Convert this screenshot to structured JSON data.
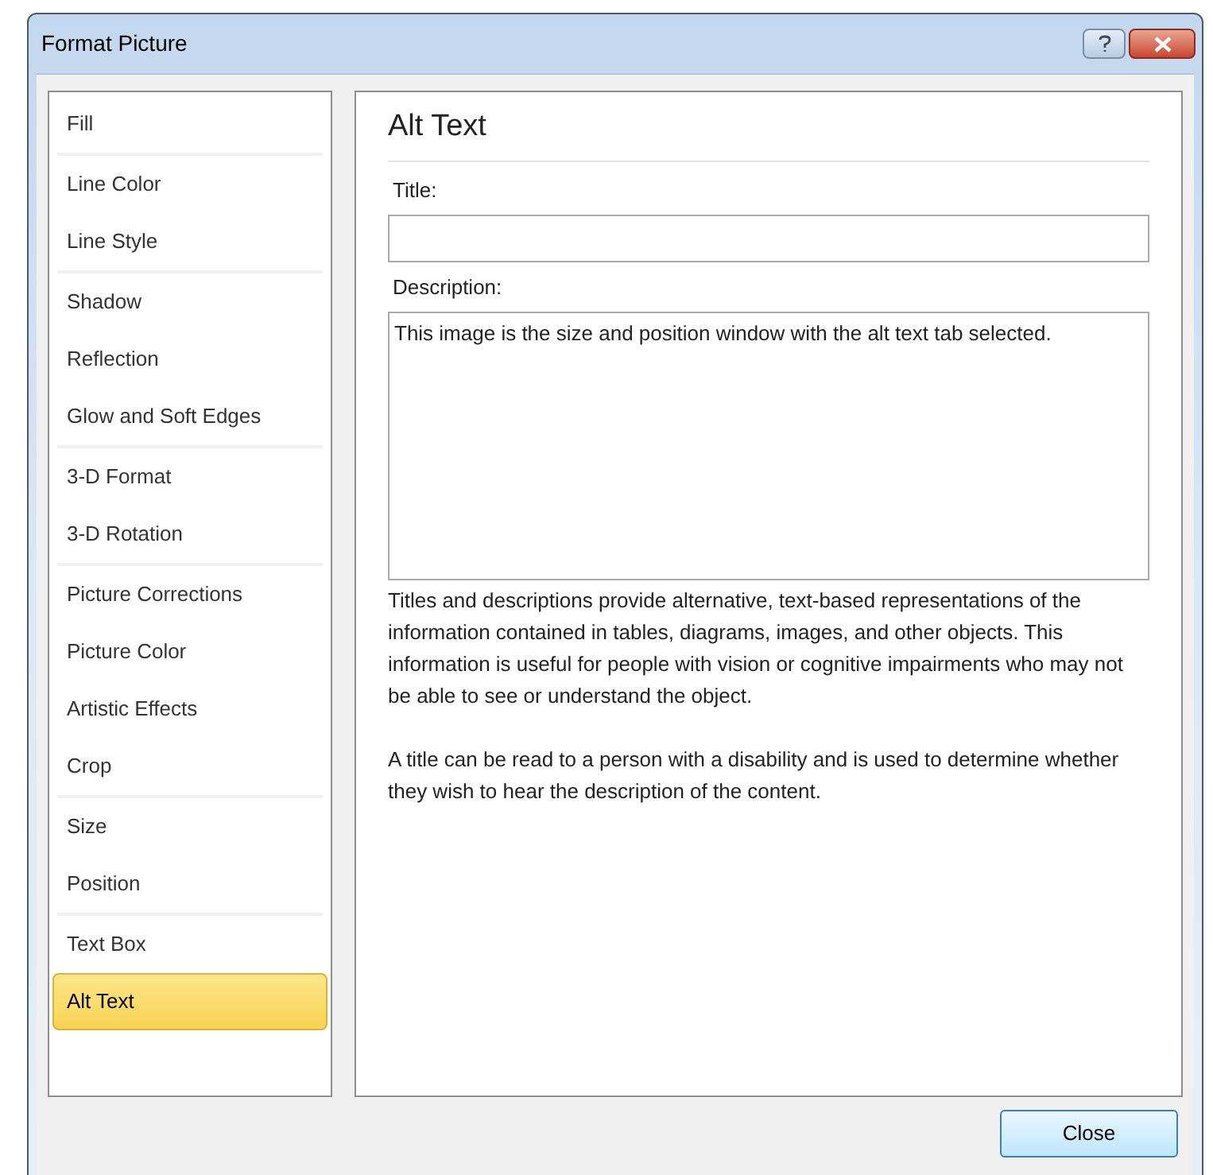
{
  "window": {
    "title": "Format Picture"
  },
  "nav_groups": [
    {
      "items": [
        {
          "label": "Fill",
          "selected": false
        }
      ]
    },
    {
      "items": [
        {
          "label": "Line Color",
          "selected": false
        },
        {
          "label": "Line Style",
          "selected": false
        }
      ]
    },
    {
      "items": [
        {
          "label": "Shadow",
          "selected": false
        },
        {
          "label": "Reflection",
          "selected": false
        },
        {
          "label": "Glow and Soft Edges",
          "selected": false
        }
      ]
    },
    {
      "items": [
        {
          "label": "3-D Format",
          "selected": false
        },
        {
          "label": "3-D Rotation",
          "selected": false
        }
      ]
    },
    {
      "items": [
        {
          "label": "Picture Corrections",
          "selected": false
        },
        {
          "label": "Picture Color",
          "selected": false
        },
        {
          "label": "Artistic Effects",
          "selected": false
        },
        {
          "label": "Crop",
          "selected": false
        }
      ]
    },
    {
      "items": [
        {
          "label": "Size",
          "selected": false
        },
        {
          "label": "Position",
          "selected": false
        }
      ]
    },
    {
      "items": [
        {
          "label": "Text Box",
          "selected": false
        },
        {
          "label": "Alt Text",
          "selected": true
        }
      ]
    }
  ],
  "panel": {
    "heading": "Alt Text",
    "title_label": "Title:",
    "description_label": "Description:",
    "description_value": "This image is the size and position window with the alt text tab selected.",
    "paragraphs": [
      "Titles and descriptions provide alternative, text-based representations of the information contained in tables, diagrams, images, and other objects. This information is useful for people with vision or cognitive impairments who may not be able to see or understand the object.",
      "A title can be read to a person with a disability and is used to determine whether they wish to hear the description of the content."
    ]
  },
  "buttons": [
    "Close"
  ]
}
